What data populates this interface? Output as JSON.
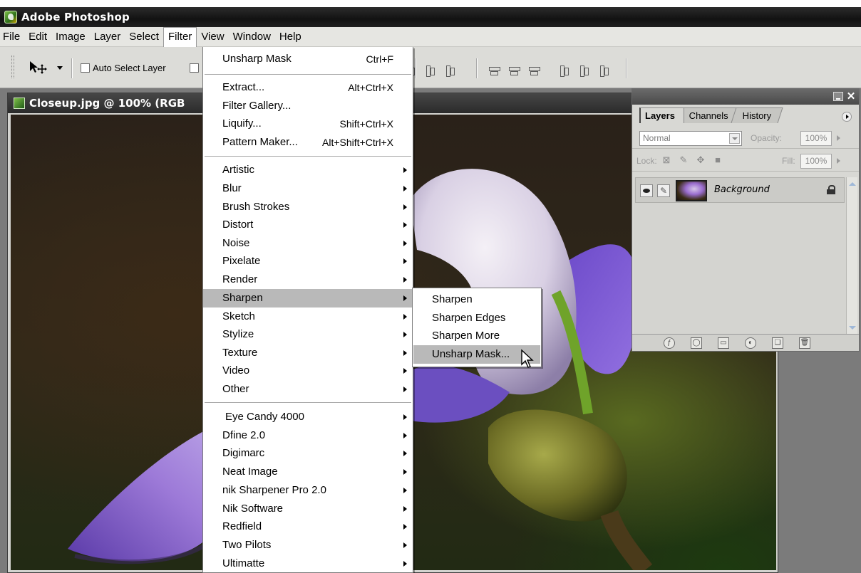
{
  "app": {
    "title": "Adobe Photoshop"
  },
  "menubar": {
    "items": [
      "File",
      "Edit",
      "Image",
      "Layer",
      "Select",
      "Filter",
      "View",
      "Window",
      "Help"
    ],
    "active": "Filter"
  },
  "options": {
    "auto_select_label": "Auto Select Layer"
  },
  "document": {
    "title": "Closeup.jpg @ 100% (RGB"
  },
  "filter_menu": {
    "last_filter": {
      "label": "Unsharp Mask",
      "shortcut": "Ctrl+F"
    },
    "group1": [
      {
        "label": "Extract...",
        "shortcut": "Alt+Ctrl+X"
      },
      {
        "label": "Filter Gallery...",
        "shortcut": ""
      },
      {
        "label": "Liquify...",
        "shortcut": "Shift+Ctrl+X"
      },
      {
        "label": "Pattern Maker...",
        "shortcut": "Alt+Shift+Ctrl+X"
      }
    ],
    "group2": [
      "Artistic",
      "Blur",
      "Brush Strokes",
      "Distort",
      "Noise",
      "Pixelate",
      "Render",
      "Sharpen",
      "Sketch",
      "Stylize",
      "Texture",
      "Video",
      "Other"
    ],
    "highlighted": "Sharpen",
    "group3": [
      "Eye Candy 4000",
      "Dfine 2.0",
      "Digimarc",
      "Neat Image",
      "nik Sharpener Pro 2.0",
      "Nik Software",
      "Redfield",
      "Two Pilots",
      "Ultimatte"
    ]
  },
  "sharpen_submenu": {
    "items": [
      "Sharpen",
      "Sharpen Edges",
      "Sharpen More",
      "Unsharp Mask..."
    ],
    "highlighted": "Unsharp Mask..."
  },
  "layers_palette": {
    "tabs": [
      "Layers",
      "Channels",
      "History"
    ],
    "active_tab": "Layers",
    "blend_mode": "Normal",
    "opacity_label": "Opacity:",
    "opacity_value": "100%",
    "lock_label": "Lock:",
    "fill_label": "Fill:",
    "fill_value": "100%",
    "layer_name": "Background"
  },
  "colors": {
    "menu_highlight": "#b9b9b9",
    "title_bar": "#1a1a1a",
    "workspace": "#7b7b7b"
  }
}
